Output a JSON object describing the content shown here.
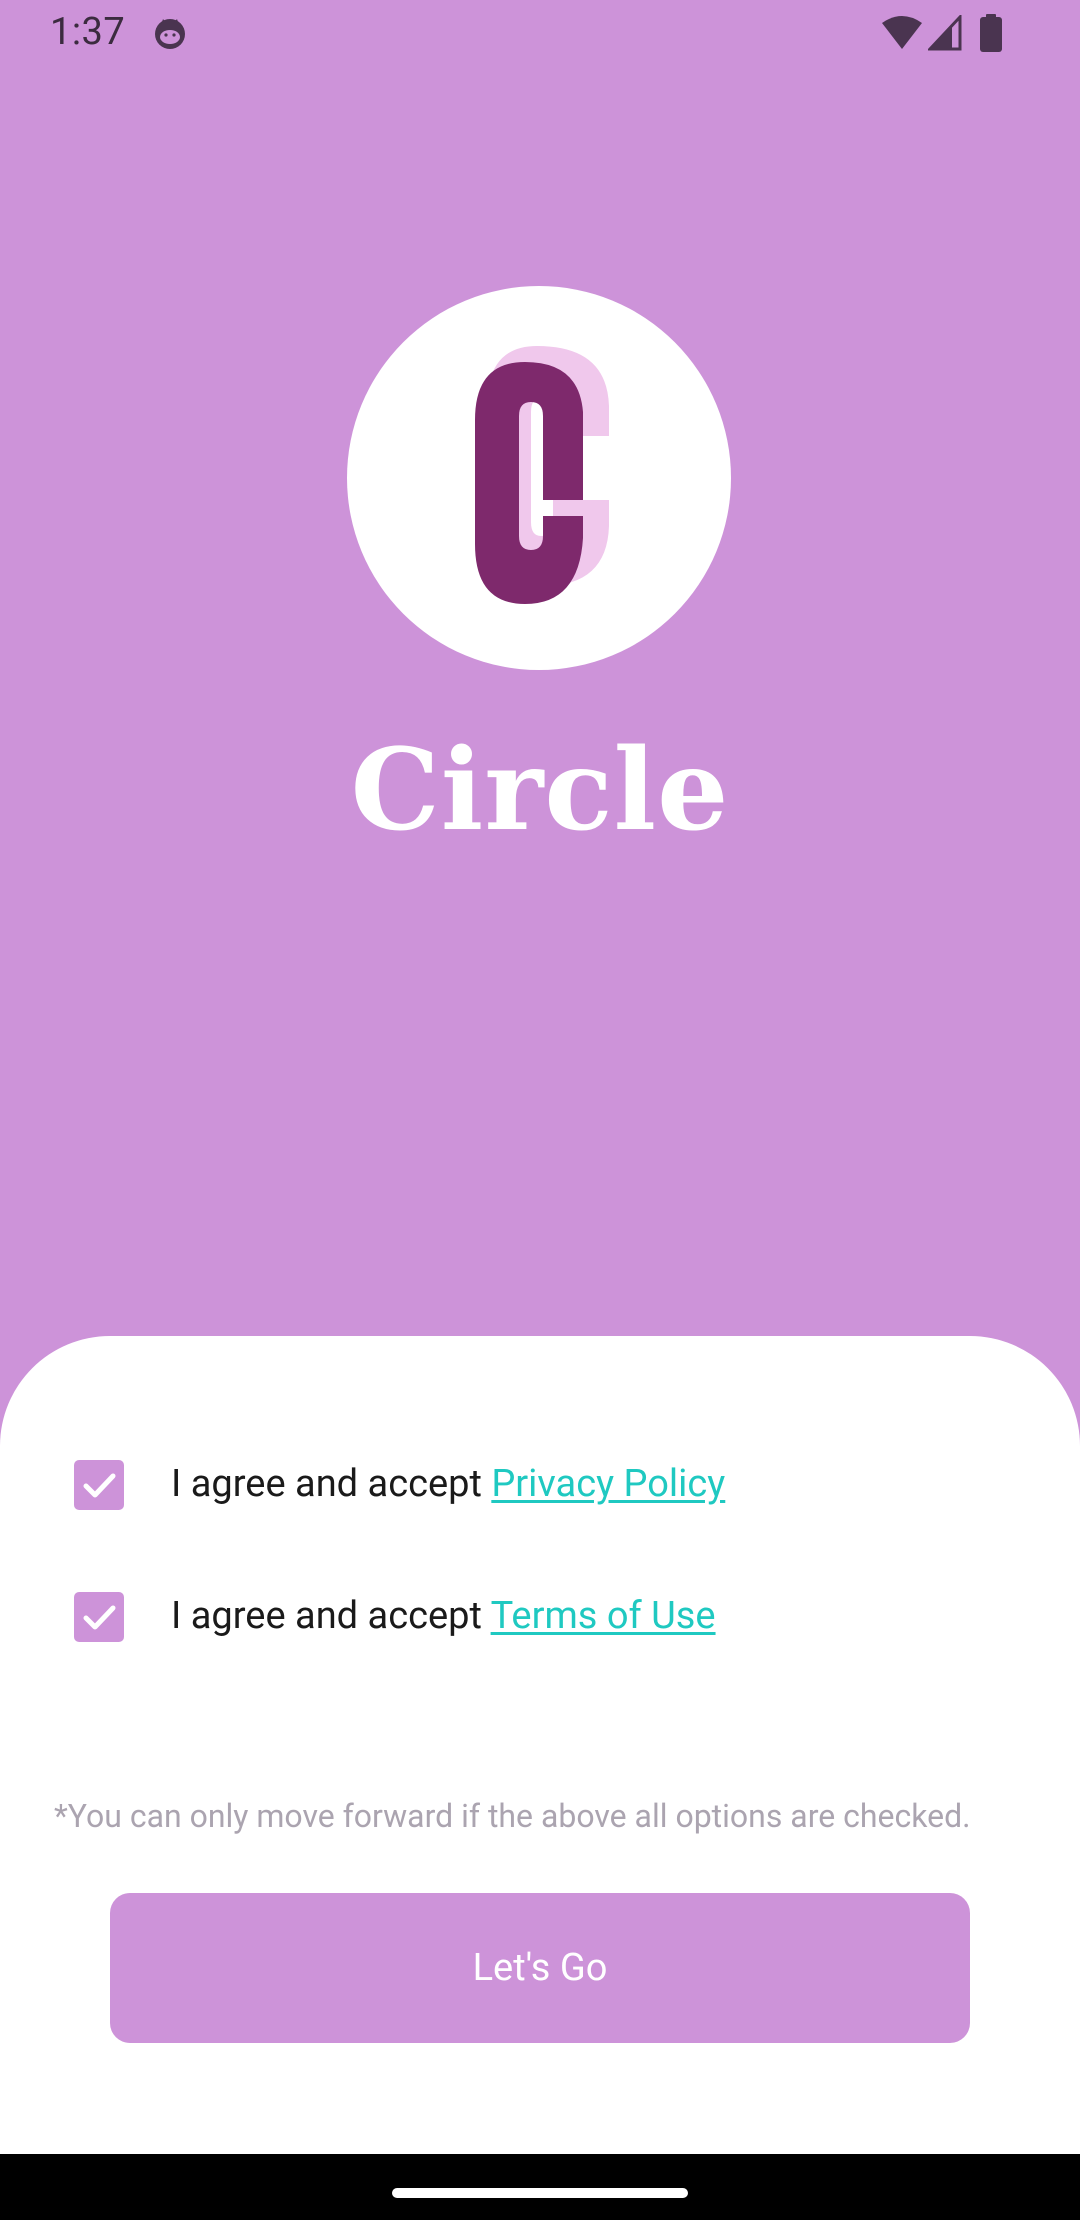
{
  "status_bar": {
    "time": "1:37",
    "icons": [
      "notification-cat-icon",
      "wifi-icon",
      "cell-signal-icon",
      "battery-icon"
    ]
  },
  "app": {
    "name": "Circle",
    "logo_letter": "C"
  },
  "agreements": [
    {
      "prefix": "I agree and accept ",
      "link": "Privacy Policy",
      "checked": true
    },
    {
      "prefix": "I agree and accept ",
      "link": "Terms of Use",
      "checked": true
    }
  ],
  "note": "*You can only move forward if the above all options are checked.",
  "primary_button": {
    "label": "Let's Go"
  },
  "colors": {
    "background": "#CD93D9",
    "sheet": "#FFFFFF",
    "link": "#1FC9C1",
    "logo_letter": "#7E296C",
    "logo_shadow": "#F0C8EC",
    "note_text": "#ABA4B0"
  }
}
